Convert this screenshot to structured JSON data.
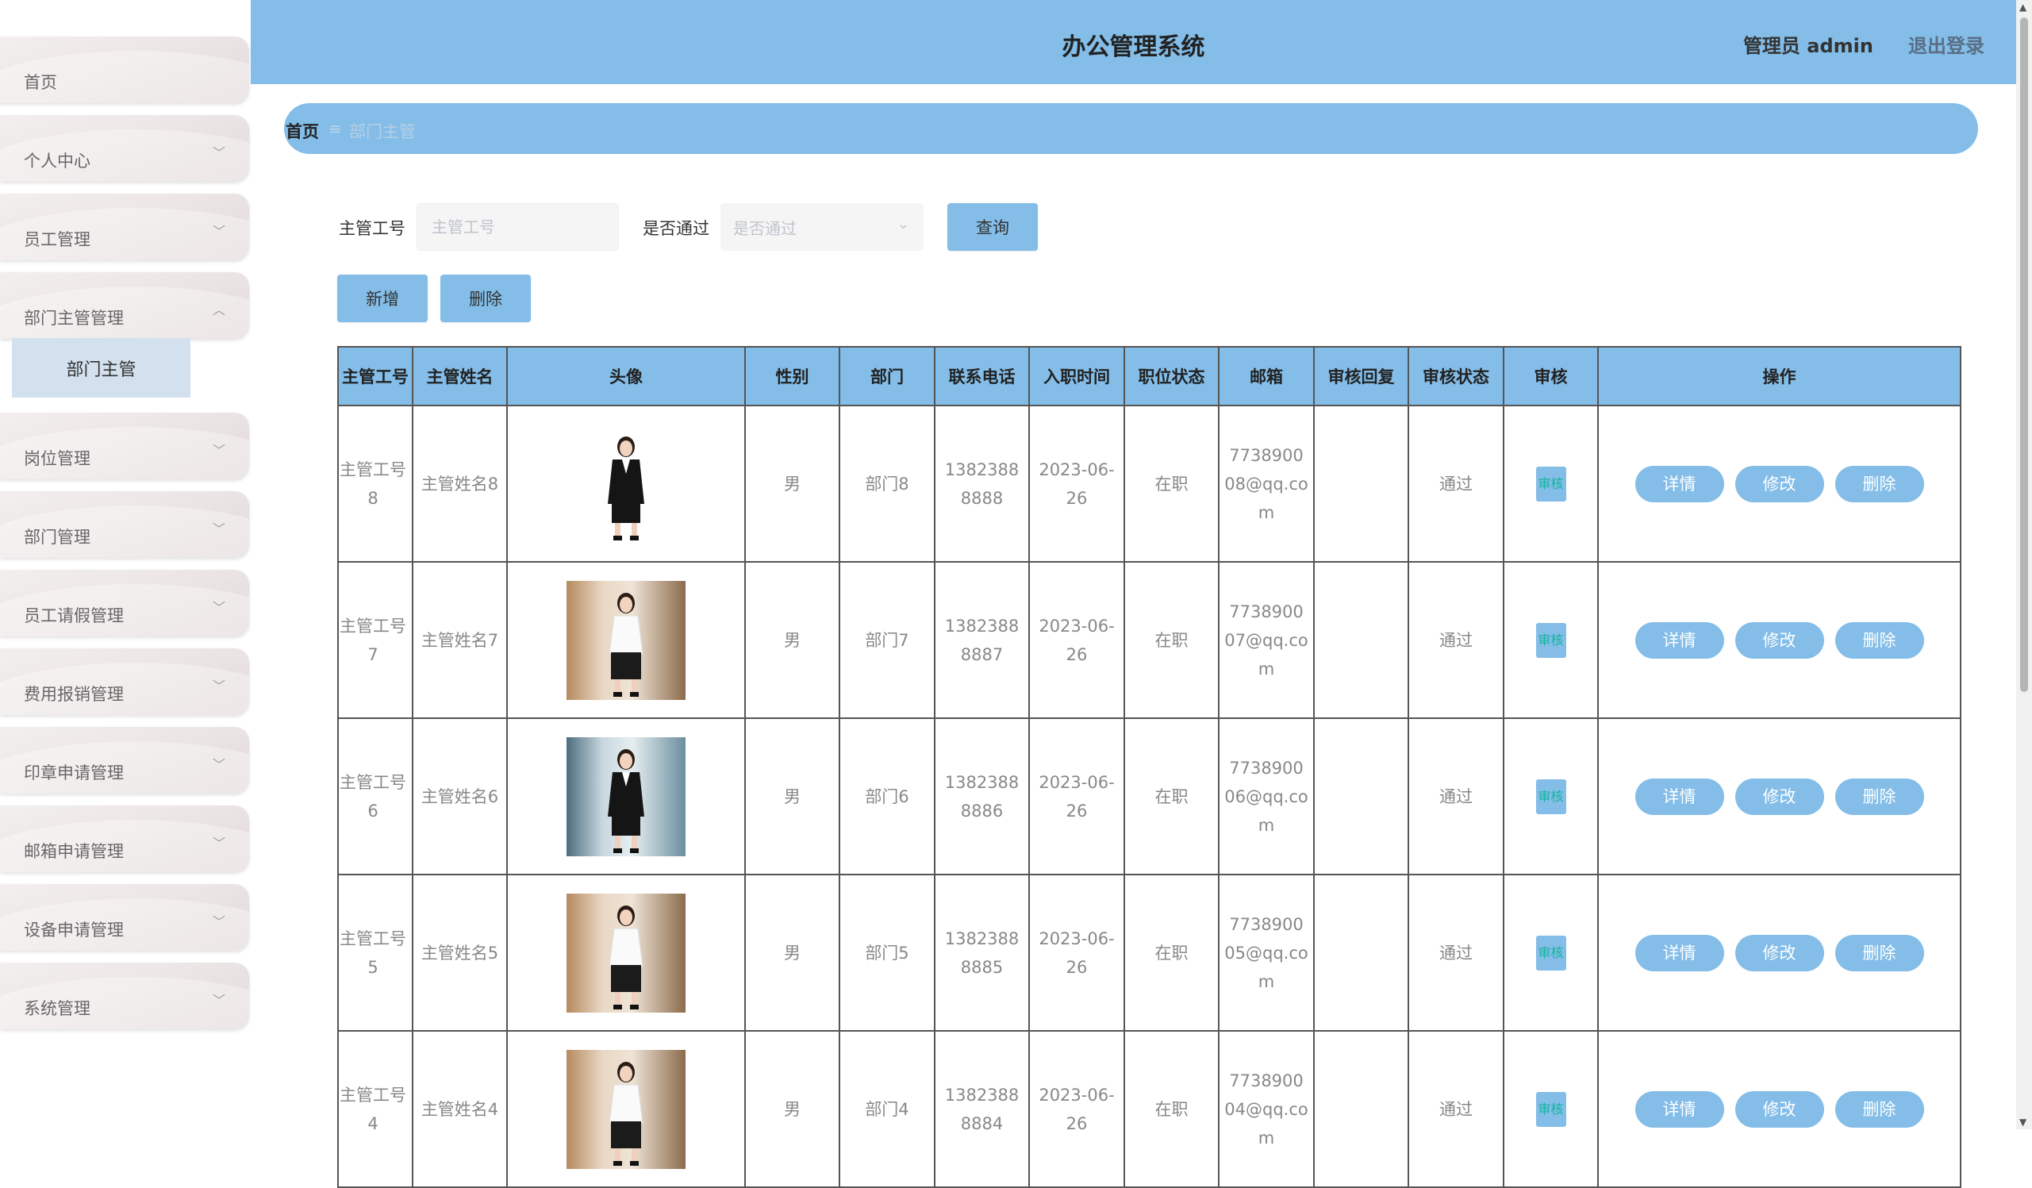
{
  "header": {
    "title": "办公管理系统",
    "admin_label": "管理员 admin",
    "logout_label": "退出登录"
  },
  "sidebar": {
    "items": [
      {
        "label": "首页",
        "has_chevron": false
      },
      {
        "label": "个人中心",
        "has_chevron": true
      },
      {
        "label": "员工管理",
        "has_chevron": true
      },
      {
        "label": "部门主管管理",
        "has_chevron": true,
        "expanded": true
      },
      {
        "label": "岗位管理",
        "has_chevron": true
      },
      {
        "label": "部门管理",
        "has_chevron": true
      },
      {
        "label": "员工请假管理",
        "has_chevron": true
      },
      {
        "label": "费用报销管理",
        "has_chevron": true
      },
      {
        "label": "印章申请管理",
        "has_chevron": true
      },
      {
        "label": "邮箱申请管理",
        "has_chevron": true
      },
      {
        "label": "设备申请管理",
        "has_chevron": true
      },
      {
        "label": "系统管理",
        "has_chevron": true
      }
    ],
    "subitem": "部门主管"
  },
  "breadcrumb": {
    "home": "首页",
    "separator": "≡",
    "current": "部门主管"
  },
  "search": {
    "field1_label": "主管工号",
    "field1_placeholder": "主管工号",
    "field2_label": "是否通过",
    "field2_placeholder": "是否通过",
    "query_button": "查询"
  },
  "actions": {
    "add_button": "新增",
    "delete_button": "删除"
  },
  "table": {
    "columns": [
      "主管工号",
      "主管姓名",
      "头像",
      "性别",
      "部门",
      "联系电话",
      "入职时间",
      "职位状态",
      "邮箱",
      "审核回复",
      "审核状态",
      "审核",
      "操作"
    ],
    "review_label": "审核",
    "op_labels": {
      "detail": "详情",
      "edit": "修改",
      "delete": "删除"
    },
    "rows": [
      {
        "id": "主管工号8",
        "name": "主管姓名8",
        "gender": "男",
        "dept": "部门8",
        "phone": "13823888888",
        "date": "2023-06-26",
        "status": "在职",
        "email": "773890008@qq.com",
        "reply": "",
        "audit": "通过"
      },
      {
        "id": "主管工号7",
        "name": "主管姓名7",
        "gender": "男",
        "dept": "部门7",
        "phone": "13823888887",
        "date": "2023-06-26",
        "status": "在职",
        "email": "773890007@qq.com",
        "reply": "",
        "audit": "通过"
      },
      {
        "id": "主管工号6",
        "name": "主管姓名6",
        "gender": "男",
        "dept": "部门6",
        "phone": "13823888886",
        "date": "2023-06-26",
        "status": "在职",
        "email": "773890006@qq.com",
        "reply": "",
        "audit": "通过"
      },
      {
        "id": "主管工号5",
        "name": "主管姓名5",
        "gender": "男",
        "dept": "部门5",
        "phone": "13823888885",
        "date": "2023-06-26",
        "status": "在职",
        "email": "773890005@qq.com",
        "reply": "",
        "audit": "通过"
      },
      {
        "id": "主管工号4",
        "name": "主管姓名4",
        "gender": "男",
        "dept": "部门4",
        "phone": "13823888884",
        "date": "2023-06-26",
        "status": "在职",
        "email": "773890004@qq.com",
        "reply": "",
        "audit": "通过"
      }
    ]
  },
  "colors": {
    "accent": "#83bde8",
    "sidebar_bg": "#ebe4e4",
    "submenu_bg": "#d3e0ee"
  }
}
